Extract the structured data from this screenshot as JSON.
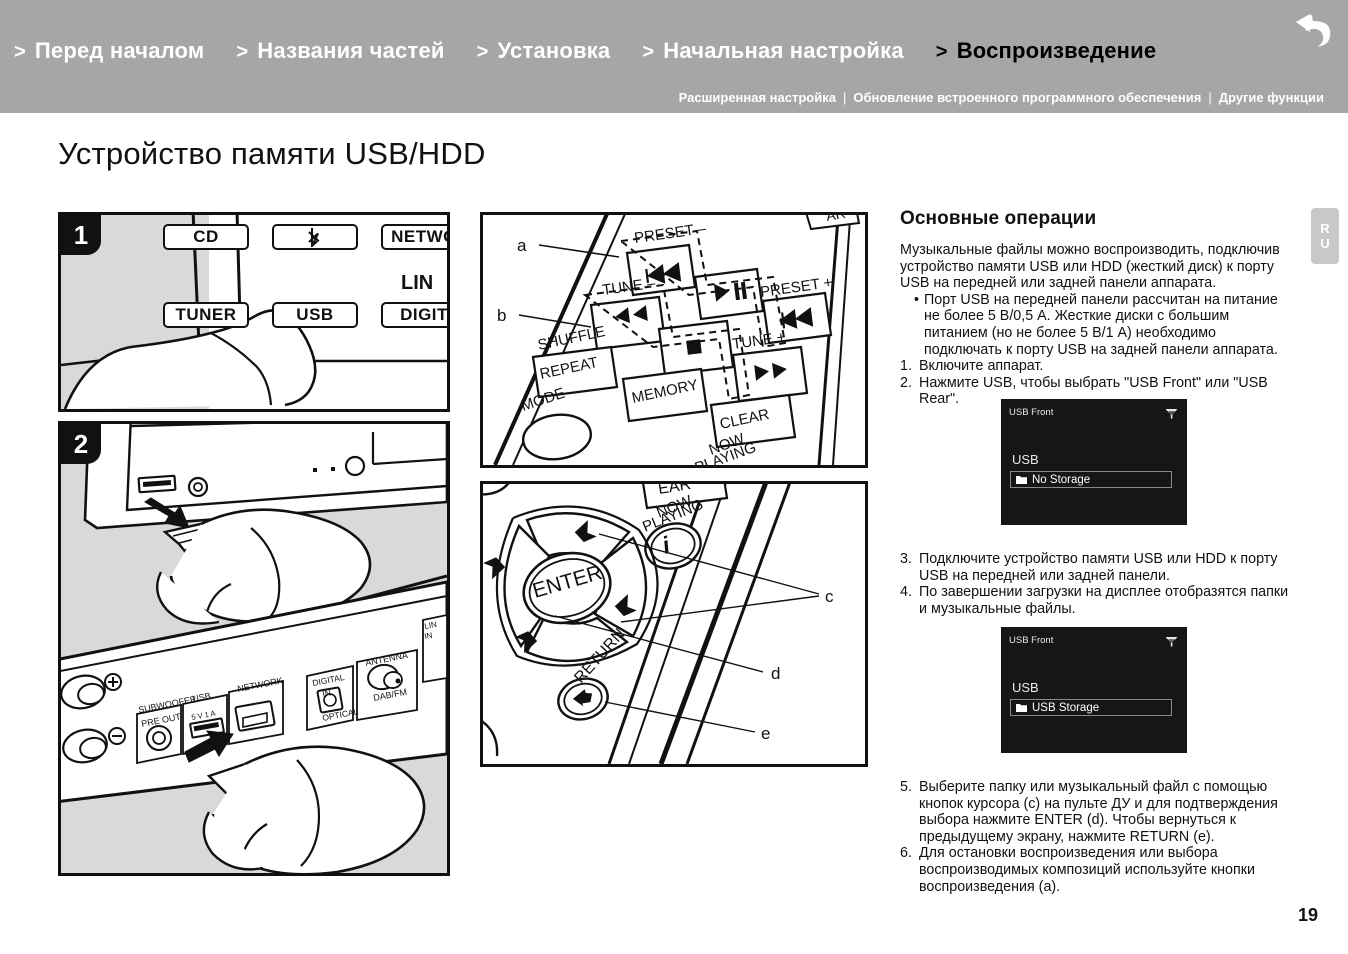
{
  "header": {
    "nav": [
      {
        "chevron": ">",
        "label": "Перед началом",
        "active": false
      },
      {
        "chevron": ">",
        "label": "Названия частей",
        "active": false
      },
      {
        "chevron": ">",
        "label": "Установка",
        "active": false
      },
      {
        "chevron": ">",
        "label": "Начальная настройка",
        "active": false
      },
      {
        "chevron": ">",
        "label": "Воспроизведение",
        "active": true
      }
    ],
    "subnav": [
      "Расширенная настройка",
      "Обновление встроенного программного обеспечения",
      "Другие функции"
    ],
    "subnav_separator": "|",
    "back_icon": "back-arrow-icon",
    "bg_color": "#a6a6a6",
    "active_color": "#000000",
    "inactive_color": "#ffffff"
  },
  "language_tab": {
    "line1": "R",
    "line2": "U"
  },
  "page_title": "Устройство памяти USB/HDD",
  "page_number": "19",
  "panel1": {
    "badge": "1",
    "buttons": [
      {
        "label": "CD"
      },
      {
        "label": "bluetooth-icon"
      },
      {
        "label": "NETWO"
      },
      {
        "label": "TUNER"
      },
      {
        "label": "USB"
      },
      {
        "label": "DIGIT"
      }
    ],
    "free_labels": [
      "LIN"
    ]
  },
  "panel2": {
    "badge": "2",
    "rear_labels": [
      "SUBWOOFER",
      "PRE OUT",
      "USB",
      "5 V 1 A",
      "NETWORK",
      "DIGITAL",
      "IN",
      "OPTICAL",
      "ANTENNA",
      "DAB/FM",
      "LIN",
      "IN"
    ]
  },
  "panel3": {
    "callouts": [
      "a",
      "b"
    ],
    "buttons": [
      "PRESET −",
      "PRESET +",
      "TUNE −",
      "TUNE +",
      "SHUFFLE",
      "REPEAT",
      "MEMORY",
      "CLEAR",
      "MODE",
      "NOW",
      "PLAYING"
    ]
  },
  "panel4": {
    "callouts": [
      "c",
      "d",
      "e"
    ],
    "buttons": [
      "ENTER",
      "RETURN",
      "NOW",
      "PLAYING",
      "EAR"
    ]
  },
  "right": {
    "heading": "Основные операции",
    "intro": "Музыкальные файлы можно воспроизводить, подключив устройство памяти USB или HDD (жесткий диск) к порту USB на передней или задней панели аппарата.",
    "bullets": [
      "Порт USB на передней панели рассчитан на питание не более 5 В/0,5 А. Жесткие диски с большим питанием (но не более 5 В/1 А) необходимо подключать к порту USB на задней панели аппарата."
    ],
    "steps_1_2": [
      {
        "num": "1.",
        "text": "Включите аппарат."
      },
      {
        "num": "2.",
        "text": "Нажмите USB, чтобы выбрать \"USB Front\" или \"USB Rear\"."
      }
    ],
    "steps_3_4": [
      {
        "num": "3.",
        "text": "Подключите устройство памяти USB или HDD к порту USB на передней или задней панели."
      },
      {
        "num": "4.",
        "text": "По завершении загрузки на дисплее отобразятся папки и музыкальные файлы."
      }
    ],
    "steps_5_6": [
      {
        "num": "5.",
        "text": "Выберите папку или музыкальный файл с помощью кнопок курсора (c) на пульте ДУ и для подтверждения выбора нажмите ENTER (d). Чтобы вернуться к предыдущему экрану, нажмите RETURN (e)."
      },
      {
        "num": "6.",
        "text": "Для остановки воспроизведения или выбора воспроизводимых композиций используйте кнопки воспроизведения (a)."
      }
    ]
  },
  "screen1": {
    "title": "USB Front",
    "wifi_icon": "wifi-icon",
    "subtitle": "USB",
    "row_icon": "folder-icon",
    "row_label": "No Storage",
    "bg_color": "#161616"
  },
  "screen2": {
    "title": "USB Front",
    "wifi_icon": "wifi-icon",
    "subtitle": "USB",
    "row_icon": "folder-icon",
    "row_label": "USB Storage",
    "bg_color": "#161616"
  }
}
